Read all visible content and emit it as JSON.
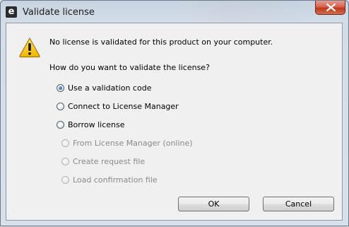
{
  "dialog": {
    "title": "Validate license",
    "app_icon_glyph": "e",
    "message": "No license is validated for this product on your computer.",
    "question": "How do you want to validate the license?",
    "options": [
      {
        "label": "Use a validation code",
        "selected": true,
        "enabled": true
      },
      {
        "label": "Connect to License Manager",
        "selected": false,
        "enabled": true
      },
      {
        "label": "Borrow license",
        "selected": false,
        "enabled": true
      }
    ],
    "borrow_options": [
      {
        "label": "From License Manager (online)",
        "selected": false,
        "enabled": false
      },
      {
        "label": "Create request file",
        "selected": false,
        "enabled": false
      },
      {
        "label": "Load confirmation file",
        "selected": false,
        "enabled": false
      }
    ],
    "ok_label": "OK",
    "cancel_label": "Cancel"
  },
  "icons": {
    "app": "app-icon",
    "close": "close-icon",
    "warning": "warning-icon"
  },
  "colors": {
    "close_button": "#c1391f",
    "warning_fill": "#f5c518",
    "radio_selected": "#1b5ea8",
    "disabled_text": "#8a8a8a"
  }
}
